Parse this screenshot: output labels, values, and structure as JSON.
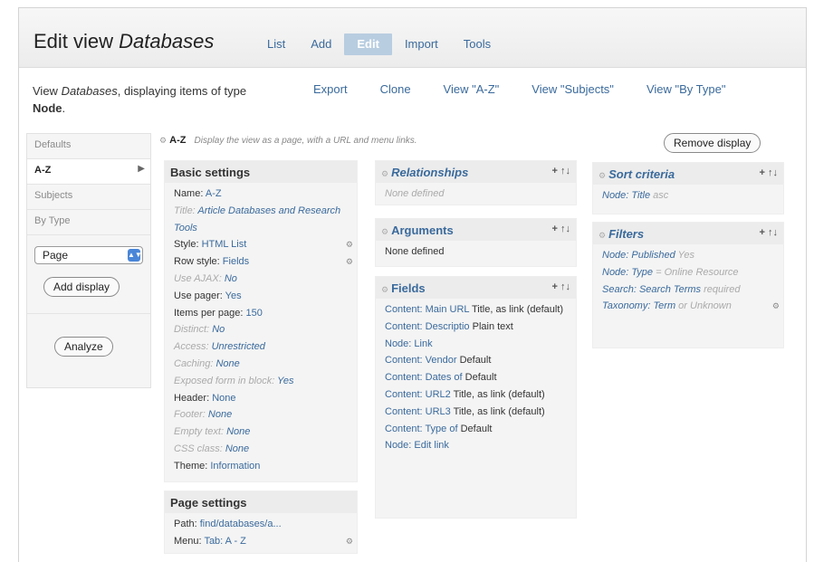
{
  "header": {
    "title_prefix": "Edit view ",
    "title_name": "Databases",
    "tabs": [
      {
        "label": "List",
        "active": false
      },
      {
        "label": "Add",
        "active": false
      },
      {
        "label": "Edit",
        "active": true
      },
      {
        "label": "Import",
        "active": false
      },
      {
        "label": "Tools",
        "active": false
      }
    ]
  },
  "subtitle": {
    "prefix": "View ",
    "view_name": "Databases",
    "middle": ", displaying items of type",
    "type": "Node",
    "type_suffix": ".",
    "links": [
      "Export",
      "Clone",
      "View \"A-Z\"",
      "View \"Subjects\"",
      "View \"By Type\""
    ]
  },
  "rail": {
    "items": [
      "Defaults",
      "A-Z",
      "Subjects",
      "By Type"
    ],
    "select_value": "Page",
    "add_display": "Add display",
    "analyze": "Analyze"
  },
  "display": {
    "name": "A-Z",
    "hint": "Display the view as a page, with a URL and menu links.",
    "remove": "Remove display"
  },
  "basic": {
    "title": "Basic settings",
    "rows": [
      {
        "k": "Name: ",
        "v": "A-Z",
        "dim": false
      },
      {
        "k": "Title: ",
        "v": "Article Databases and Research Tools",
        "dim": true
      },
      {
        "k": "Style: ",
        "v": "HTML List",
        "dim": false,
        "gear": true
      },
      {
        "k": "Row style: ",
        "v": "Fields",
        "dim": false,
        "gear": true
      },
      {
        "k": "Use AJAX: ",
        "v": "No",
        "dim": true
      },
      {
        "k": "Use pager: ",
        "v": "Yes",
        "dim": false
      },
      {
        "k": "Items per page: ",
        "v": "150",
        "dim": false
      },
      {
        "k": "Distinct: ",
        "v": "No",
        "dim": true
      },
      {
        "k": "Access: ",
        "v": "Unrestricted",
        "dim": true
      },
      {
        "k": "Caching: ",
        "v": "None",
        "dim": true
      },
      {
        "k": "Exposed form in block: ",
        "v": "Yes",
        "dim": true
      },
      {
        "k": "Header: ",
        "v": "None",
        "dim": false
      },
      {
        "k": "Footer: ",
        "v": "None",
        "dim": true
      },
      {
        "k": "Empty text: ",
        "v": "None",
        "dim": true
      },
      {
        "k": "CSS class: ",
        "v": "None",
        "dim": true
      },
      {
        "k": "Theme: ",
        "v": "Information",
        "dim": false
      }
    ]
  },
  "page_settings": {
    "title": "Page settings",
    "rows": [
      {
        "k": "Path: ",
        "v": "find/databases/a..."
      },
      {
        "k": "Menu: ",
        "v": "Tab: A - Z",
        "gear": true
      }
    ]
  },
  "relationships": {
    "title": "Relationships",
    "empty": "None defined"
  },
  "arguments": {
    "title": "Arguments",
    "empty": "None defined"
  },
  "fields": {
    "title": "Fields",
    "rows": [
      {
        "k": "Content: Main URL",
        "v": " Title, as link (default)"
      },
      {
        "k": "Content: Descriptio",
        "v": " Plain text"
      },
      {
        "k": "Node: Link",
        "v": ""
      },
      {
        "k": "Content: Vendor",
        "v": " Default"
      },
      {
        "k": "Content: Dates of",
        "v": " Default"
      },
      {
        "k": "Content: URL2",
        "v": " Title, as link (default)"
      },
      {
        "k": "Content: URL3",
        "v": " Title, as link (default)"
      },
      {
        "k": "Content: Type of",
        "v": " Default"
      },
      {
        "k": "Node: Edit link",
        "v": ""
      }
    ]
  },
  "sort": {
    "title": "Sort criteria",
    "rows": [
      {
        "k": "Node: Title",
        "v": " asc"
      }
    ]
  },
  "filters": {
    "title": "Filters",
    "rows": [
      {
        "k": "Node: Published",
        "v": " Yes"
      },
      {
        "k": "Node: Type",
        "v": " = Online Resource"
      },
      {
        "k": "Search: Search Terms",
        "v": " required"
      },
      {
        "k": "Taxonomy: Term",
        "v": " or Unknown",
        "gear": true
      }
    ]
  },
  "controls": {
    "add": "+",
    "rearrange": "↑↓"
  }
}
